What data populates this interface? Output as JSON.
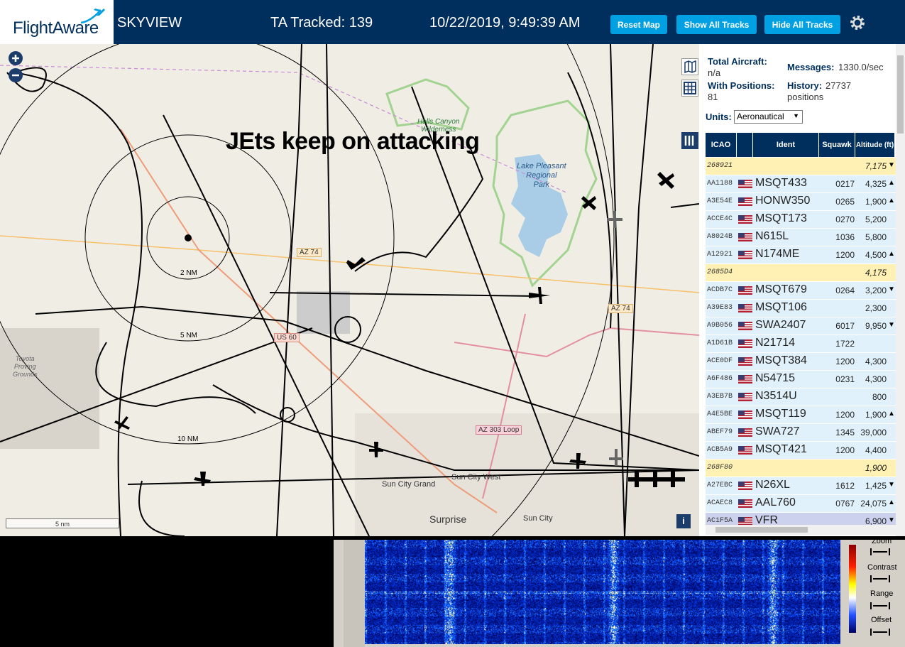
{
  "header": {
    "logo": "FlightAware",
    "app_name": "SKYVIEW",
    "tracked": "TA Tracked: 139",
    "datetime": "10/22/2019, 9:49:39 AM",
    "reset_map": "Reset Map",
    "show_all": "Show All Tracks",
    "hide_all": "Hide All Tracks",
    "settings_icon": "gear-icon"
  },
  "map": {
    "annotation": "JEts keep on attacking",
    "places": {
      "hells_canyon": "Hells Canyon",
      "wilderness": "Wilderness",
      "lake_pleasant": "Lake Pleasant",
      "regional": "Regional",
      "park": "Park",
      "toyota": "Toyota",
      "proving": "Proving",
      "grounds": "Grounds",
      "sun_city_grand": "Sun City Grand",
      "sun_city_west": "Sun City West",
      "surprise": "Surprise",
      "sun_city": "Sun City"
    },
    "roads": {
      "az74_a": "AZ 74",
      "az74_b": "AZ 74",
      "us60": "US 60",
      "az303": "AZ 303 Loop"
    },
    "rings": {
      "r2": "2 NM",
      "r5": "5 NM",
      "r10": "10 NM"
    },
    "scale": "5 nm",
    "info": "i"
  },
  "sidebar": {
    "total_aircraft_label": "Total Aircraft:",
    "total_aircraft_value": "n/a",
    "with_positions_label": "With Positions:",
    "with_positions_value": "81",
    "messages_label": "Messages:",
    "messages_value": "1330.0/sec",
    "history_label": "History:",
    "history_value": "27737",
    "history_unit": "positions",
    "units_label": "Units:",
    "units_value": "Aeronautical",
    "columns": {
      "icao": "ICAO",
      "ident": "Ident",
      "squawk": "Squawk",
      "altitude": "Altitude (ft)"
    },
    "rows": [
      {
        "icao": "268921",
        "ident": "",
        "squawk": "",
        "alt": "7,175",
        "arrow": "▼",
        "style": "yellow"
      },
      {
        "icao": "AA1188",
        "ident": "MSQT433",
        "squawk": "0217",
        "alt": "4,325",
        "arrow": "▲",
        "style": "blue"
      },
      {
        "icao": "A3E54E",
        "ident": "HONW350",
        "squawk": "0265",
        "alt": "1,900",
        "arrow": "▲",
        "style": "blue"
      },
      {
        "icao": "ACCE4C",
        "ident": "MSQT173",
        "squawk": "0270",
        "alt": "5,200",
        "arrow": "",
        "style": "blue"
      },
      {
        "icao": "A8024B",
        "ident": "N615L",
        "squawk": "1036",
        "alt": "5,800",
        "arrow": "",
        "style": "blue"
      },
      {
        "icao": "A12921",
        "ident": "N174ME",
        "squawk": "1200",
        "alt": "4,500",
        "arrow": "▲",
        "style": "blue"
      },
      {
        "icao": "2685D4",
        "ident": "",
        "squawk": "",
        "alt": "4,175",
        "arrow": "",
        "style": "yellow"
      },
      {
        "icao": "ACDB7C",
        "ident": "MSQT679",
        "squawk": "0264",
        "alt": "3,200",
        "arrow": "▼",
        "style": "blue"
      },
      {
        "icao": "A39E83",
        "ident": "MSQT106",
        "squawk": "",
        "alt": "2,300",
        "arrow": "",
        "style": "blue"
      },
      {
        "icao": "A9B056",
        "ident": "SWA2407",
        "squawk": "6017",
        "alt": "9,950",
        "arrow": "▼",
        "style": "blue"
      },
      {
        "icao": "A1D61B",
        "ident": "N21714",
        "squawk": "1722",
        "alt": "",
        "arrow": "",
        "style": "blue"
      },
      {
        "icao": "ACE0DF",
        "ident": "MSQT384",
        "squawk": "1200",
        "alt": "4,300",
        "arrow": "",
        "style": "blue"
      },
      {
        "icao": "A6F486",
        "ident": "N54715",
        "squawk": "0231",
        "alt": "4,300",
        "arrow": "",
        "style": "blue"
      },
      {
        "icao": "A3EB7B",
        "ident": "N3514U",
        "squawk": "",
        "alt": "800",
        "arrow": "",
        "style": "blue"
      },
      {
        "icao": "A4E5BE",
        "ident": "MSQT119",
        "squawk": "1200",
        "alt": "1,900",
        "arrow": "▲",
        "style": "blue"
      },
      {
        "icao": "ABEF79",
        "ident": "SWA727",
        "squawk": "1345",
        "alt": "39,000",
        "arrow": "",
        "style": "blue"
      },
      {
        "icao": "ACB5A9",
        "ident": "MSQT421",
        "squawk": "1200",
        "alt": "4,400",
        "arrow": "",
        "style": "blue"
      },
      {
        "icao": "268F80",
        "ident": "",
        "squawk": "",
        "alt": "1,900",
        "arrow": "",
        "style": "yellow"
      },
      {
        "icao": "A27EBC",
        "ident": "N26XL",
        "squawk": "1612",
        "alt": "1,425",
        "arrow": "▼",
        "style": "blue"
      },
      {
        "icao": "ACAEC8",
        "ident": "AAL760",
        "squawk": "0767",
        "alt": "24,075",
        "arrow": "▲",
        "style": "blue"
      },
      {
        "icao": "AC1F5A",
        "ident": "VFR",
        "squawk": "",
        "alt": "6,900",
        "arrow": "▼",
        "style": "selected"
      }
    ]
  },
  "spectrum": {
    "zoom": "Zoom",
    "contrast": "Contrast",
    "range": "Range",
    "offset": "Offset"
  },
  "colors": {
    "header_bg": "#002f5d",
    "button": "#00a0e2",
    "row_blue": "#e1f1fb",
    "row_yellow": "#fff1b3",
    "row_selected": "#ccd1ee"
  }
}
